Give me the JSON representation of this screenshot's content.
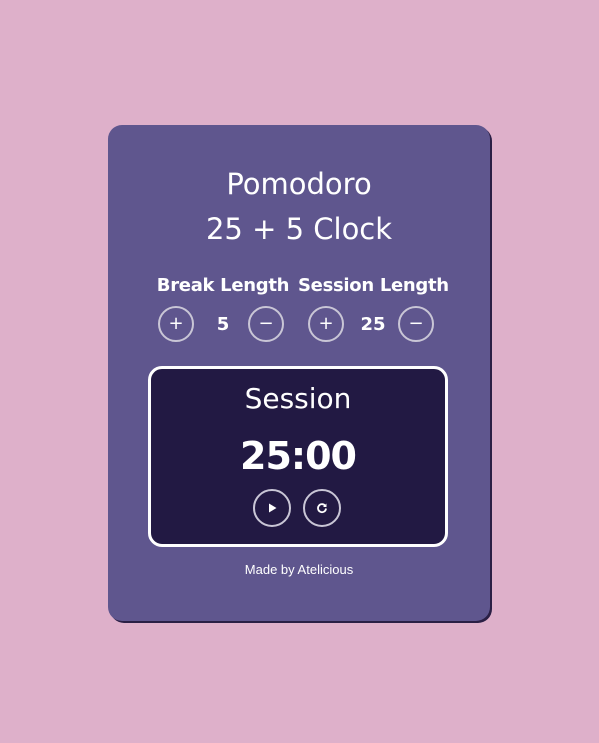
{
  "header": {
    "title_line1": "Pomodoro",
    "title_line2": "25 + 5 Clock"
  },
  "break": {
    "label": "Break Length",
    "value": "5",
    "increment_label": "+",
    "decrement_label": "−"
  },
  "session": {
    "label": "Session Length",
    "value": "25",
    "increment_label": "+",
    "decrement_label": "−"
  },
  "timer": {
    "label": "Session",
    "time": "25:00",
    "start_icon": "play-icon",
    "reset_icon": "refresh-icon"
  },
  "footer": {
    "credit": "Made by Atelicious"
  },
  "colors": {
    "page_background": "#deb0ca",
    "card_background": "#5f568e",
    "timer_background": "#221943",
    "text": "#ffffff"
  }
}
